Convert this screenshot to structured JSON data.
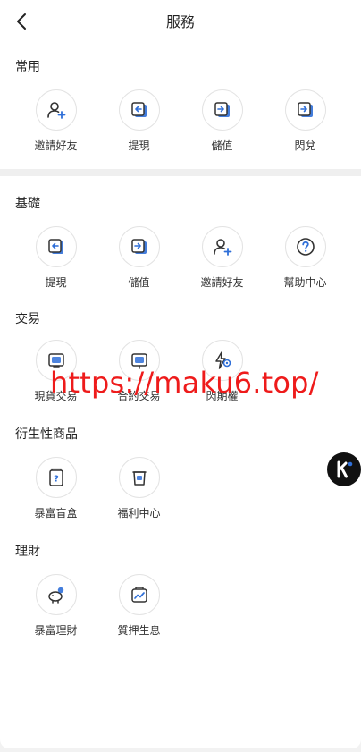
{
  "header": {
    "title": "服務",
    "back_icon": "chevron-left-icon"
  },
  "sections": [
    {
      "title": "常用",
      "items": [
        {
          "label": "邀請好友",
          "icon": "add-user-icon"
        },
        {
          "label": "提現",
          "icon": "withdraw-icon"
        },
        {
          "label": "儲值",
          "icon": "deposit-icon"
        },
        {
          "label": "閃兌",
          "icon": "flash-exchange-icon"
        }
      ]
    },
    {
      "title": "基礎",
      "items": [
        {
          "label": "提現",
          "icon": "withdraw-icon"
        },
        {
          "label": "儲值",
          "icon": "deposit-icon"
        },
        {
          "label": "邀請好友",
          "icon": "add-user-icon"
        },
        {
          "label": "幫助中心",
          "icon": "help-icon"
        }
      ]
    },
    {
      "title": "交易",
      "items": [
        {
          "label": "現貨交易",
          "icon": "spot-trade-icon"
        },
        {
          "label": "合約交易",
          "icon": "contract-trade-icon"
        },
        {
          "label": "閃期權",
          "icon": "lightning-option-icon"
        }
      ]
    },
    {
      "title": "衍生性商品",
      "items": [
        {
          "label": "暴富盲盒",
          "icon": "blind-box-icon"
        },
        {
          "label": "福利中心",
          "icon": "welfare-icon"
        }
      ]
    },
    {
      "title": "理財",
      "items": [
        {
          "label": "暴富理財",
          "icon": "piggy-bank-icon"
        },
        {
          "label": "質押生息",
          "icon": "staking-icon"
        }
      ]
    }
  ],
  "watermark": "https://maku6.top/",
  "float_button": {
    "icon": "k-logo-icon"
  },
  "colors": {
    "accent": "#2f6fd8",
    "watermark": "#ee1b1b",
    "divider": "#efefef"
  }
}
